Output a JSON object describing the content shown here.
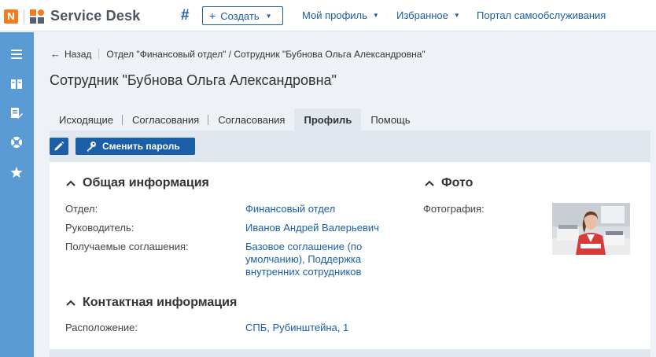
{
  "header": {
    "logo_letter": "N",
    "app_name": "Service Desk",
    "hash_icon": "hash-icon",
    "create_label": "Создать",
    "nav": [
      {
        "label": "Мой профиль"
      },
      {
        "label": "Избранное"
      },
      {
        "label": "Портал самообслуживания"
      }
    ]
  },
  "sidebar": {
    "icons": [
      "menu-icon",
      "book-icon",
      "edit-list-icon",
      "lifebuoy-icon",
      "star-icon"
    ]
  },
  "breadcrumb": {
    "back_label": "Назад",
    "path": "Отдел \"Финансовый отдел\" / Сотрудник \"Бубнова Ольга Александровна\""
  },
  "page_title": "Сотрудник \"Бубнова Ольга Александровна\"",
  "tabs": [
    {
      "label": "Исходящие"
    },
    {
      "label": "Согласования"
    },
    {
      "label": "Согласования"
    },
    {
      "label": "Профиль"
    },
    {
      "label": "Помощь"
    }
  ],
  "toolbar": {
    "change_password_label": "Сменить пароль"
  },
  "general": {
    "title": "Общая информация",
    "rows": [
      {
        "label": "Отдел:",
        "value": "Финансовый отдел"
      },
      {
        "label": "Руководитель:",
        "value": "Иванов Андрей Валерьевич"
      },
      {
        "label": "Получаемые соглашения:",
        "value_lines": [
          "Базовое соглашение (по",
          "умолчанию), Поддержка",
          "внутренних сотрудников"
        ]
      }
    ]
  },
  "contact": {
    "title": "Контактная информация",
    "rows": [
      {
        "label": "Расположение:",
        "value": "СПБ, Рубинштейна, 1"
      }
    ]
  },
  "photo_section": {
    "title": "Фото",
    "label": "Фотография:"
  },
  "colors": {
    "accent": "#1a5fa8",
    "brand_orange": "#f47c20",
    "sidebar": "#5b9bd5",
    "tab_active": "#e1e7ef"
  }
}
